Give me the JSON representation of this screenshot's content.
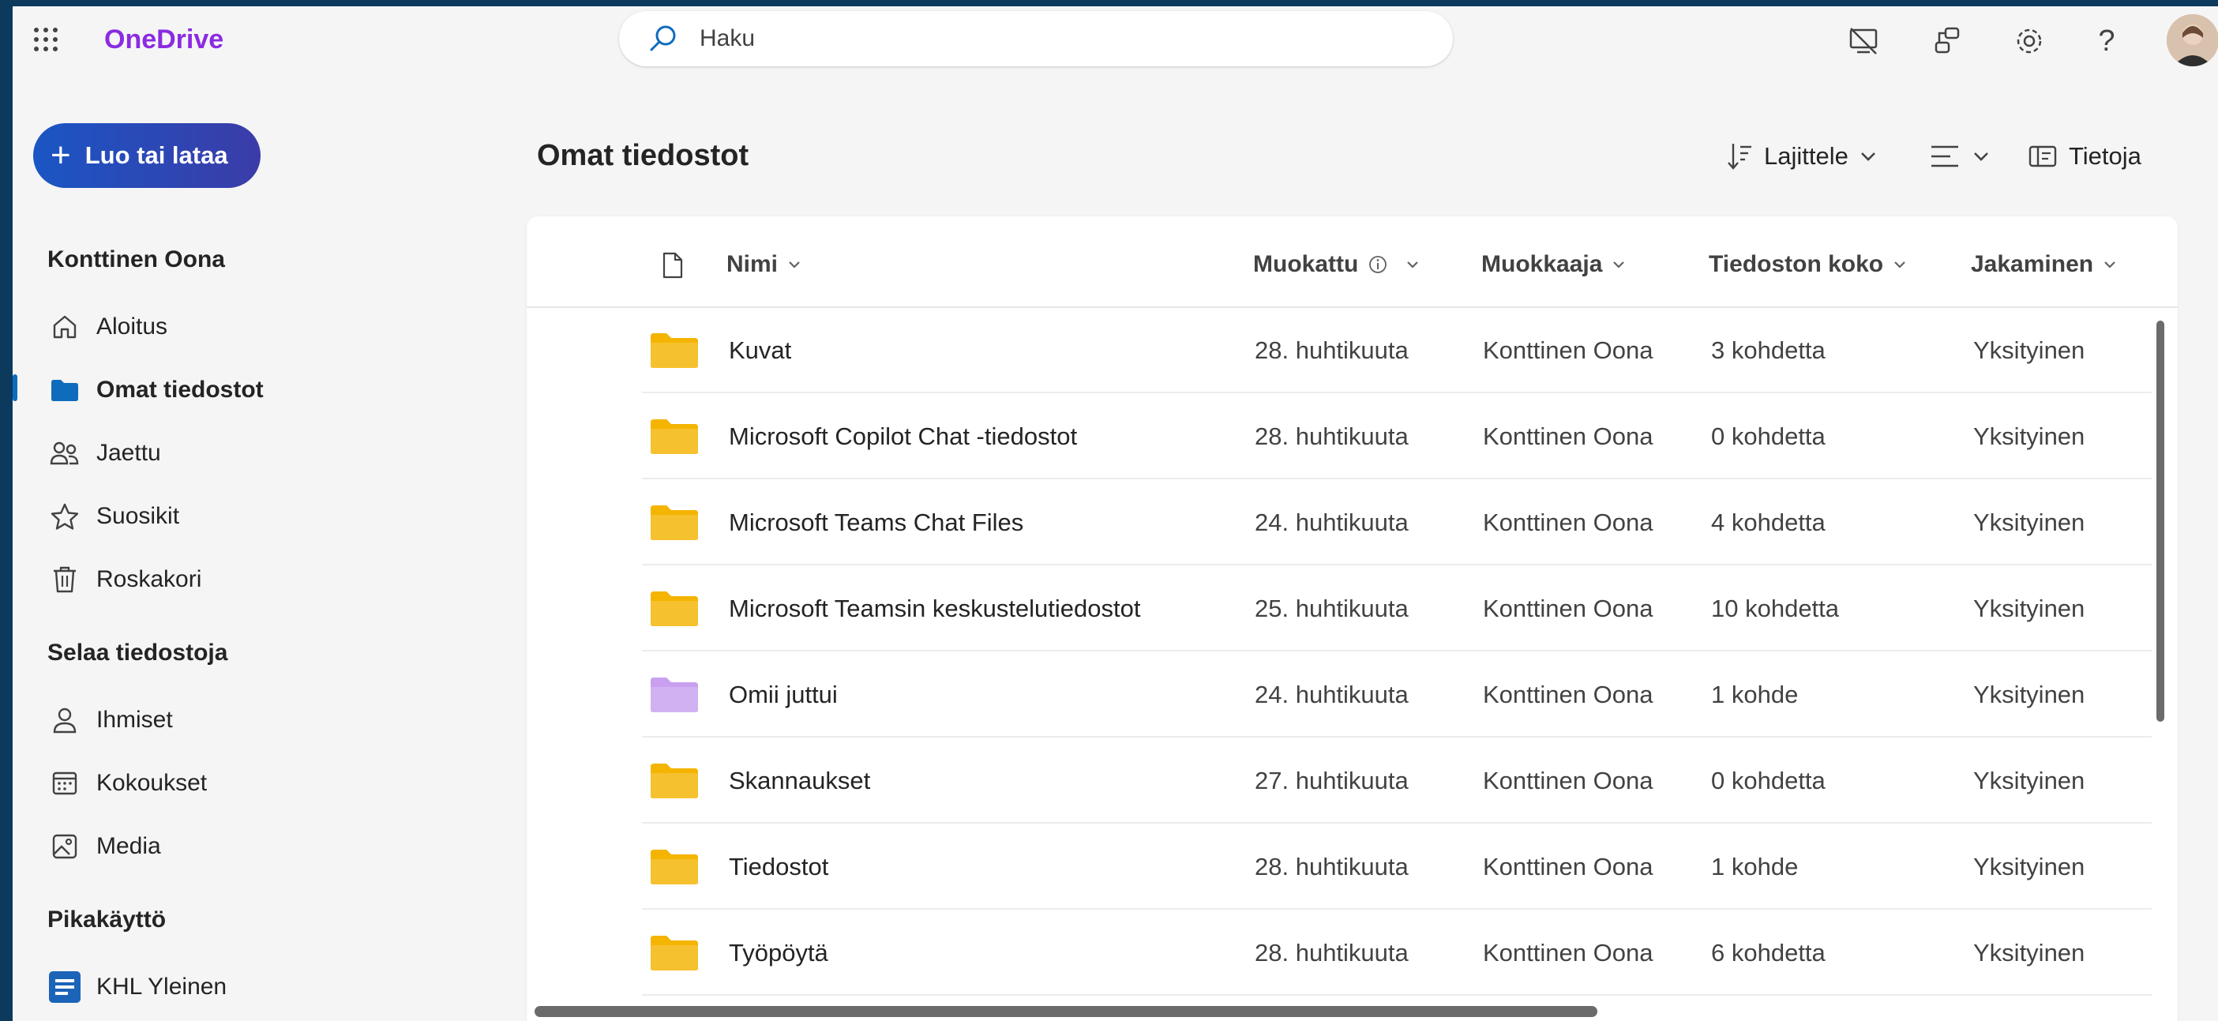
{
  "app": {
    "brand": "OneDrive",
    "accent": "#8a2be2",
    "search_placeholder": "Haku"
  },
  "topbar": {
    "icons": [
      "no-screen-share-icon",
      "diagram-icon",
      "settings-gear-icon",
      "help-icon"
    ],
    "help_glyph": "?"
  },
  "create_button": {
    "label": "Luo tai lataa",
    "plus": "+"
  },
  "sidebar": {
    "user_heading": "Konttinen Oona",
    "items": [
      {
        "label": "Aloitus",
        "icon": "home-icon"
      },
      {
        "label": "Omat tiedostot",
        "icon": "folder-icon",
        "active": true
      },
      {
        "label": "Jaettu",
        "icon": "people-icon"
      },
      {
        "label": "Suosikit",
        "icon": "star-icon"
      },
      {
        "label": "Roskakori",
        "icon": "trash-icon"
      }
    ],
    "browse_heading": "Selaa tiedostoja",
    "browse_items": [
      {
        "label": "Ihmiset",
        "icon": "person-icon"
      },
      {
        "label": "Kokoukset",
        "icon": "calendar-icon"
      },
      {
        "label": "Media",
        "icon": "image-icon"
      }
    ],
    "quick_heading": "Pikakäyttö",
    "quick_items": [
      {
        "label": "KHL Yleinen",
        "icon": "site-logo-icon"
      }
    ]
  },
  "main": {
    "title": "Omat tiedostot",
    "commands": {
      "sort": "Lajittele",
      "details": "Tietoja"
    },
    "columns": {
      "name": "Nimi",
      "modified": "Muokattu",
      "modifier": "Muokkaaja",
      "size": "Tiedoston koko",
      "sharing": "Jakaminen"
    },
    "rows": [
      {
        "name": "Kuvat",
        "modified": "28. huhtikuuta",
        "modifier": "Konttinen Oona",
        "size": "3 kohdetta",
        "sharing": "Yksityinen",
        "folder_color": "#f4b400"
      },
      {
        "name": "Microsoft Copilot Chat -tiedostot",
        "modified": "28. huhtikuuta",
        "modifier": "Konttinen Oona",
        "size": "0 kohdetta",
        "sharing": "Yksityinen",
        "folder_color": "#f4b400"
      },
      {
        "name": "Microsoft Teams Chat Files",
        "modified": "24. huhtikuuta",
        "modifier": "Konttinen Oona",
        "size": "4 kohdetta",
        "sharing": "Yksityinen",
        "folder_color": "#f4b400"
      },
      {
        "name": "Microsoft Teamsin keskustelutiedostot",
        "modified": "25. huhtikuuta",
        "modifier": "Konttinen Oona",
        "size": "10 kohdetta",
        "sharing": "Yksityinen",
        "folder_color": "#f4b400"
      },
      {
        "name": "Omii juttui",
        "modified": "24. huhtikuuta",
        "modifier": "Konttinen Oona",
        "size": "1 kohde",
        "sharing": "Yksityinen",
        "folder_color": "#c9a0f0"
      },
      {
        "name": "Skannaukset",
        "modified": "27. huhtikuuta",
        "modifier": "Konttinen Oona",
        "size": "0 kohdetta",
        "sharing": "Yksityinen",
        "folder_color": "#f4b400"
      },
      {
        "name": "Tiedostot",
        "modified": "28. huhtikuuta",
        "modifier": "Konttinen Oona",
        "size": "1 kohde",
        "sharing": "Yksityinen",
        "folder_color": "#f4b400"
      },
      {
        "name": "Työpöytä",
        "modified": "28. huhtikuuta",
        "modifier": "Konttinen Oona",
        "size": "6 kohdetta",
        "sharing": "Yksityinen",
        "folder_color": "#f4b400"
      }
    ]
  }
}
